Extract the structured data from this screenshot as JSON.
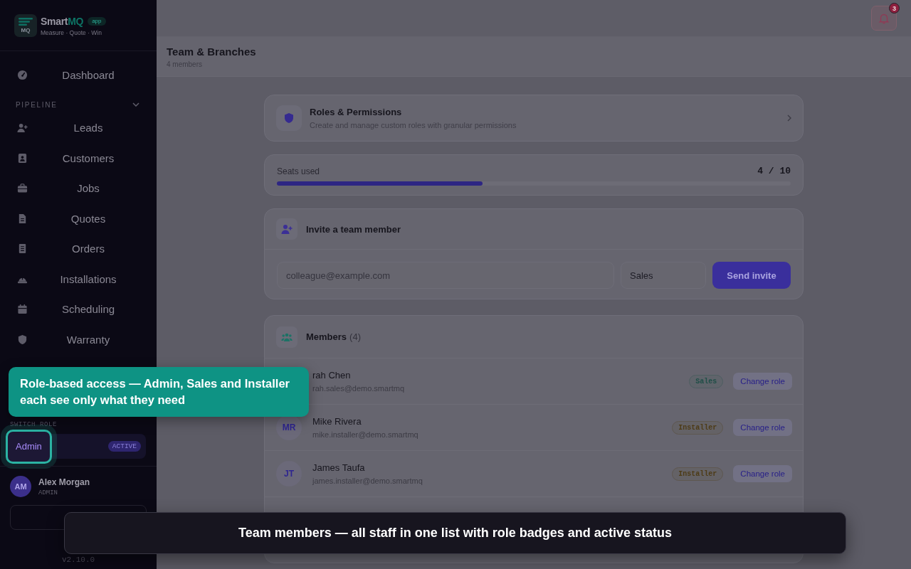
{
  "sidebar": {
    "logo": {
      "mark": "MQ",
      "name": "Smart",
      "name_accent": "MQ",
      "badge": "app",
      "tagline": "Measure · Quote · Win"
    },
    "items": [
      {
        "kind": "link",
        "label": "Dashboard",
        "selected": false
      },
      {
        "kind": "section",
        "label": "PIPELINE",
        "expanded": true
      },
      {
        "kind": "link",
        "label": "Leads",
        "selected": false
      },
      {
        "kind": "link",
        "label": "Customers",
        "selected": false
      },
      {
        "kind": "link",
        "label": "Jobs",
        "selected": false
      },
      {
        "kind": "link",
        "label": "Quotes",
        "selected": false
      },
      {
        "kind": "link",
        "label": "Orders",
        "selected": false
      },
      {
        "kind": "link",
        "label": "Installations",
        "selected": false
      },
      {
        "kind": "link",
        "label": "Scheduling",
        "selected": false
      },
      {
        "kind": "link",
        "label": "Warranty",
        "selected": false
      }
    ],
    "role_switcher": {
      "label": "SWITCH ROLE",
      "roles": [
        {
          "label": "Admin",
          "badge": "ACTIVE",
          "selected": true,
          "highlighted": true
        }
      ]
    },
    "user": {
      "initials": "AM",
      "name": "Alex Morgan",
      "role": "ADMIN"
    },
    "version": "v2.10.0"
  },
  "topbar": {
    "notifications": {
      "count": "3"
    }
  },
  "header": {
    "title": "Team & Branches",
    "subtitle": "4 members"
  },
  "roles_card": {
    "title": "Roles & Permissions",
    "description": "Create and manage custom roles with granular permissions"
  },
  "seats": {
    "label": "Seats used",
    "reading": "4 / 10",
    "level": 0.4
  },
  "invite": {
    "title": "Invite a team member",
    "email": {
      "placeholder": "colleague@example.com"
    },
    "role": {
      "value": "Sales"
    },
    "button": "Send invite"
  },
  "members": {
    "title": "Members",
    "count": "(4)",
    "rows": [
      {
        "name": "rah Chen",
        "email": "rah.sales@demo.smartmq",
        "role": {
          "label": "Sales",
          "color": "#1f4e47"
        },
        "action": "Change role"
      },
      {
        "initials": "MR",
        "name": "Mike Rivera",
        "email": "mike.installer@demo.smartmq",
        "role": {
          "label": "Installer",
          "color": "#4d3b16"
        },
        "action": "Change role"
      },
      {
        "initials": "JT",
        "name": "James Taufa",
        "email": "james.installer@demo.smartmq",
        "role": {
          "label": "Installer",
          "color": "#4d3b16"
        },
        "action": "Change role"
      }
    ]
  },
  "tour": {
    "tooltip": "Role-based access — Admin, Sales and Installer each see only what they need",
    "caption": "Team members — all staff in one list with role badges and active status"
  }
}
